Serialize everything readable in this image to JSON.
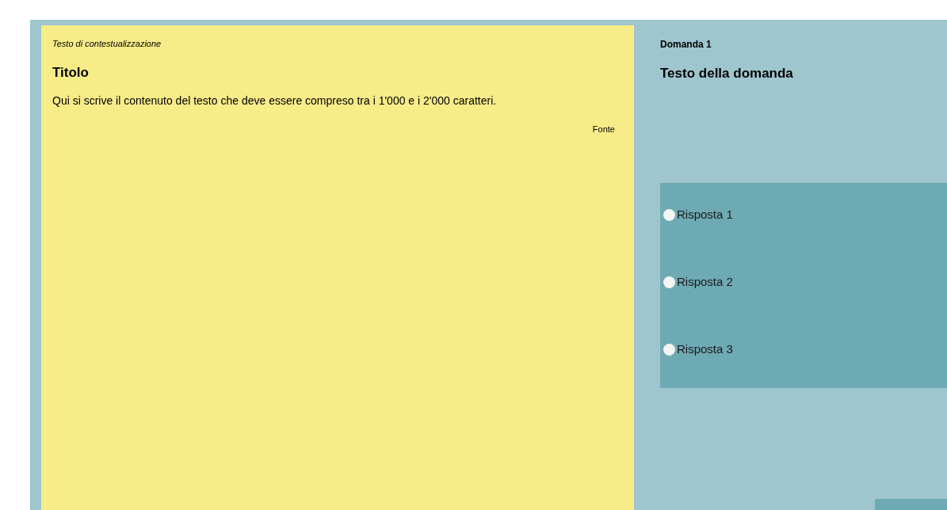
{
  "context": {
    "label": "Testo di contestualizzazione",
    "title": "Titolo",
    "body": "Qui si scrive il contenuto del testo che deve essere compreso tra i 1'000 e i 2'000 caratteri.",
    "source": "Fonte"
  },
  "question": {
    "number": "Domanda 1",
    "text": "Testo della domanda",
    "answers": [
      {
        "label": "Risposta 1",
        "selected": false
      },
      {
        "label": "Risposta 2",
        "selected": false
      },
      {
        "label": "Risposta 3",
        "selected": false
      }
    ]
  }
}
